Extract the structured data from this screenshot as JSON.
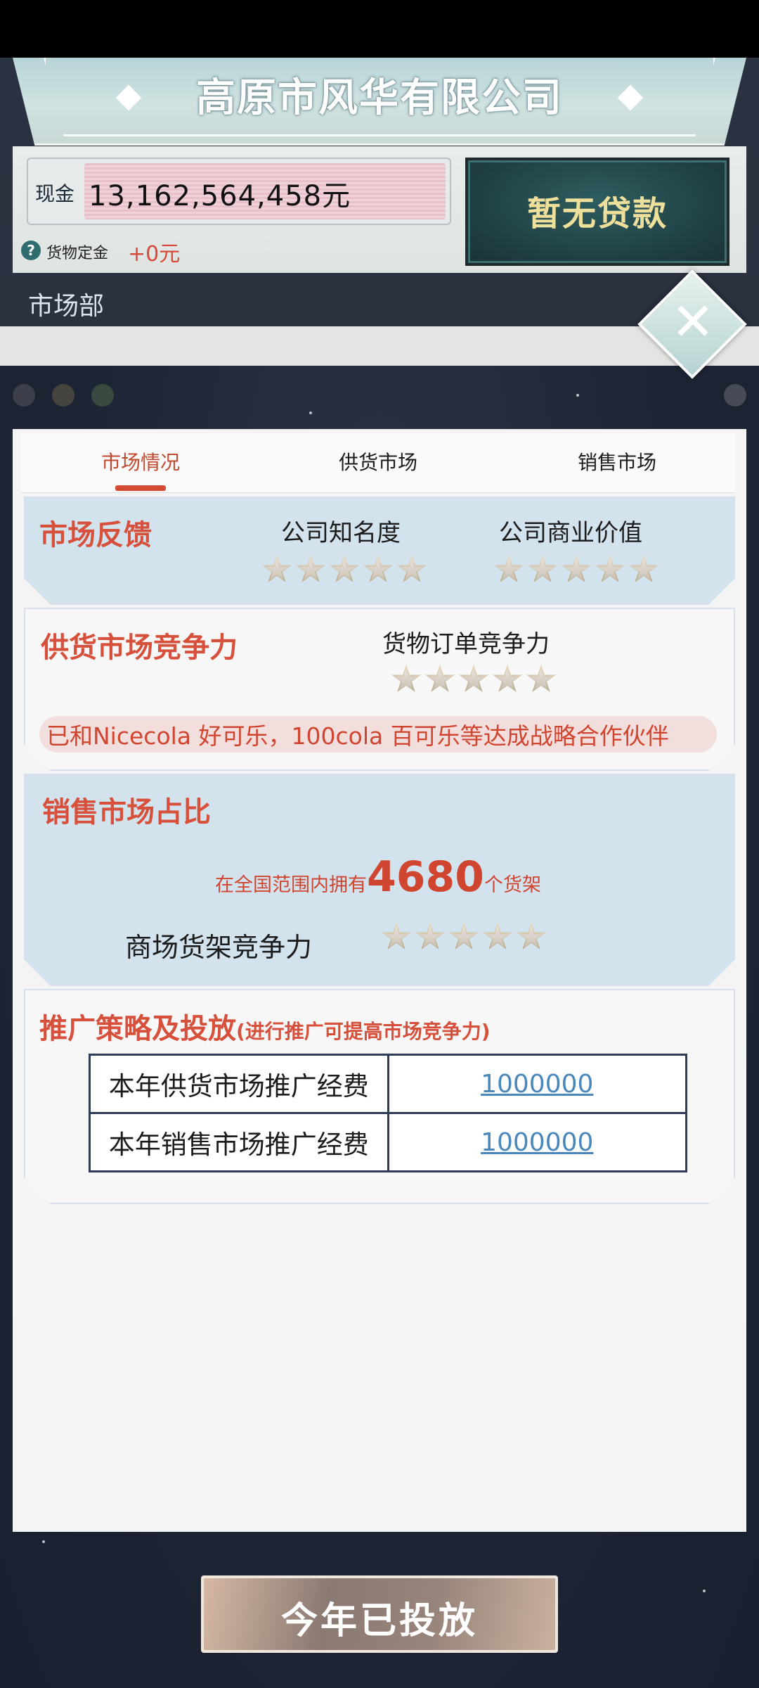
{
  "header": {
    "company_name": "高原市风华有限公司",
    "cash_label": "现金",
    "cash_value": "13,162,564,458元",
    "deposit_label": "货物定金",
    "deposit_value": "+0元",
    "loan_button": "暂无贷款",
    "department": "市场部",
    "close_icon": "close-icon"
  },
  "tabs": [
    {
      "label": "市场情况",
      "active": true
    },
    {
      "label": "供货市场",
      "active": false
    },
    {
      "label": "销售市场",
      "active": false
    }
  ],
  "feedback": {
    "title": "市场反馈",
    "awareness_label": "公司知名度",
    "awareness_stars": 0,
    "value_label": "公司商业价值",
    "value_stars": 0
  },
  "supply": {
    "title": "供货市场竞争力",
    "order_label": "货物订单竞争力",
    "order_stars": 0,
    "partner_text": "已和Nicecola 好可乐，100cola 百可乐等达成战略合作伙伴"
  },
  "sales": {
    "title": "销售市场占比",
    "shelf_prefix": "在全国范围内拥有",
    "shelf_count": "4680",
    "shelf_suffix": "个货架",
    "mall_label": "商场货架竞争力",
    "mall_stars": 0
  },
  "promotion": {
    "title": "推广策略及投放",
    "subtitle": "(进行推广可提高市场竞争力)",
    "rows": [
      {
        "label": "本年供货市场推广经费",
        "value": "1000000"
      },
      {
        "label": "本年销售市场推广经费",
        "value": "1000000"
      }
    ]
  },
  "footer": {
    "button": "今年已投放"
  },
  "colors": {
    "accent_red": "#d6503b",
    "section_blue": "#d3e3ee",
    "link_blue": "#4a88bb",
    "loan_text": "#eedf9b"
  }
}
